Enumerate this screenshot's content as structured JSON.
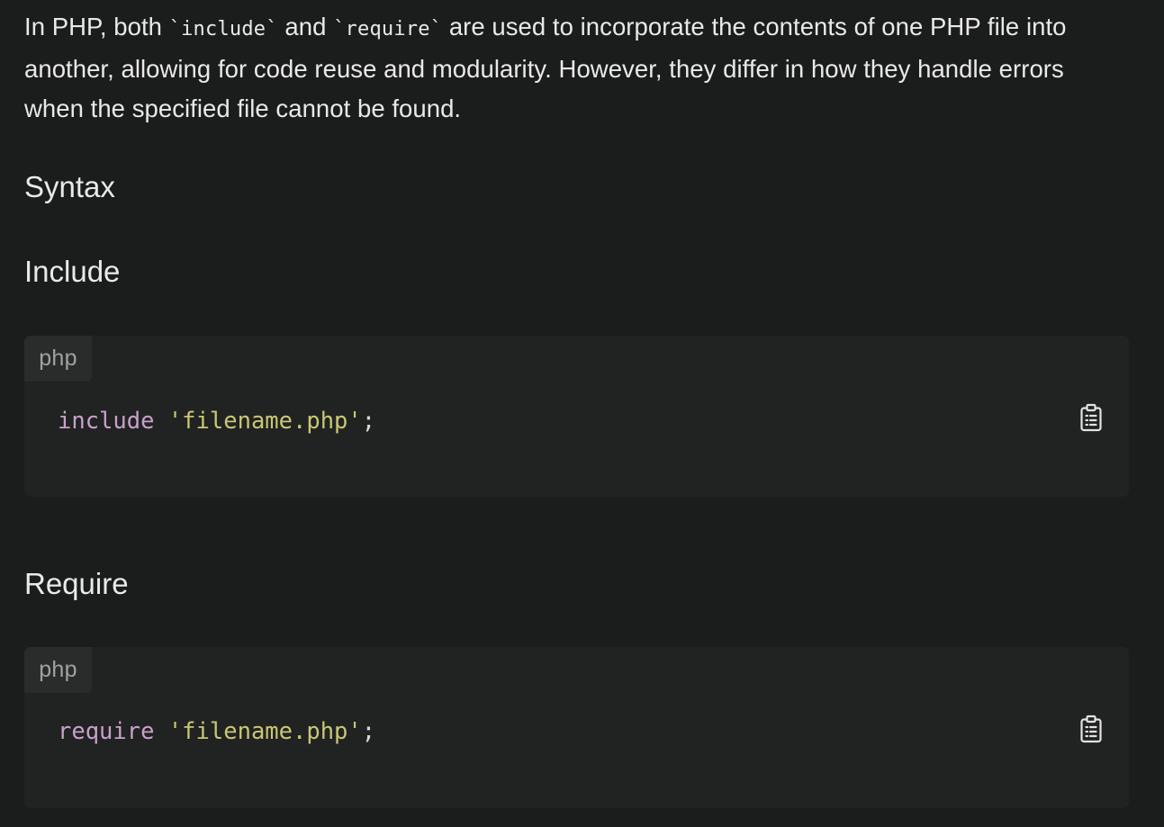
{
  "intro": {
    "part1": "In PHP, both ",
    "code1": "`include`",
    "part2": " and ",
    "code2": "`require`",
    "part3": " are used to incorporate the contents of one PHP file into another, allowing for code reuse and modularity. However, they differ in how they handle errors when the specified file cannot be found."
  },
  "headings": {
    "syntax": "Syntax",
    "include": "Include",
    "require": "Require"
  },
  "code_blocks": [
    {
      "language": "php",
      "keyword": "include",
      "string": "'filename.php'",
      "terminator": ";",
      "copy_icon": "clipboard-icon"
    },
    {
      "language": "php",
      "keyword": "require",
      "string": "'filename.php'",
      "terminator": ";",
      "copy_icon": "clipboard-icon"
    }
  ],
  "colors": {
    "background": "#1b1c1c",
    "code_background": "#212222",
    "keyword": "#c7a1c9",
    "string": "#c9c774",
    "text": "#e9e9e7"
  }
}
